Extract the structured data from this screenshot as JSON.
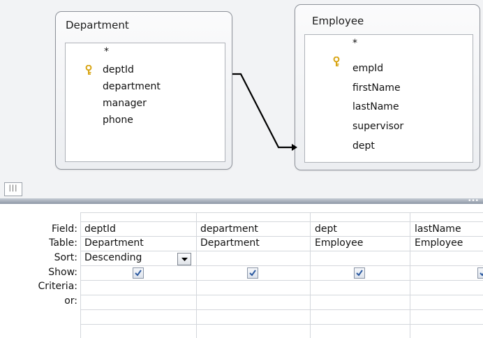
{
  "tables": {
    "department": {
      "title": "Department",
      "fields": [
        "*",
        "deptId",
        "department",
        "manager",
        "phone"
      ],
      "primary_key": "deptId"
    },
    "employee": {
      "title": "Employee",
      "fields": [
        "*",
        "empId",
        "firstName",
        "lastName",
        "supervisor",
        "dept"
      ],
      "primary_key": "empId"
    }
  },
  "relationship": {
    "from": "Department.deptId",
    "to": "Employee.dept"
  },
  "grid": {
    "row_labels": [
      "Field:",
      "Table:",
      "Sort:",
      "Show:",
      "Criteria:",
      "or:"
    ],
    "columns": [
      {
        "field": "deptId",
        "table": "Department",
        "sort": "Descending",
        "show": true
      },
      {
        "field": "department",
        "table": "Department",
        "sort": "",
        "show": true
      },
      {
        "field": "dept",
        "table": "Employee",
        "sort": "",
        "show": true
      },
      {
        "field": "lastName",
        "table": "Employee",
        "sort": "",
        "show": true
      }
    ]
  },
  "colors": {
    "key_icon": "#d8a514",
    "checkmark": "#2c5aa0",
    "splitter": "#8c96a5"
  }
}
